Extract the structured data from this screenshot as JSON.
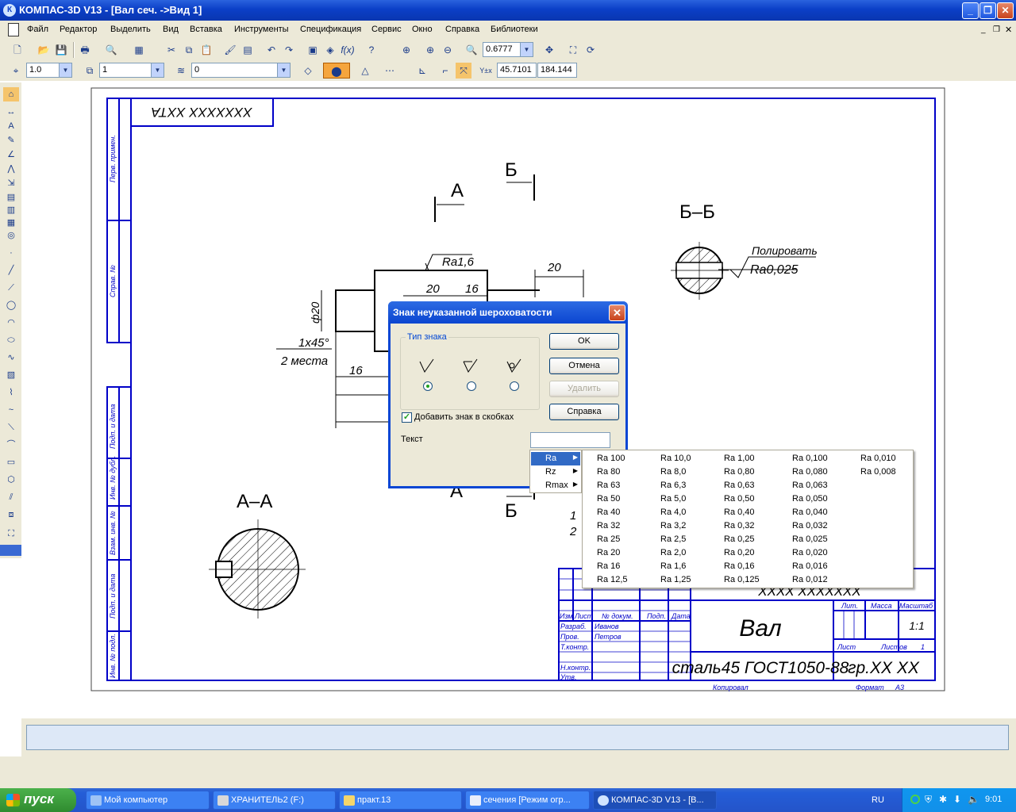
{
  "window": {
    "title": "КОМПАС-3D V13 - [Вал сеч. ->Вид 1]",
    "app_icon": "К"
  },
  "menu": [
    "Файл",
    "Редактор",
    "Выделить",
    "Вид",
    "Вставка",
    "Инструменты",
    "Спецификация",
    "Сервис",
    "Окно",
    "Справка",
    "Библиотеки"
  ],
  "toolbar": {
    "zoom": "0.6777",
    "style_value": "1.0",
    "layer_value": "1",
    "state_value": "0",
    "coord_x": "45.7101",
    "coord_y": "184.144"
  },
  "drawing": {
    "doc_code": "XXXXXXX XXTA",
    "section_a_label": "А",
    "section_b_label": "Б",
    "section_bb_title": "Б–Б",
    "section_aa_title": "А–А",
    "roughness_top": "Ra1,6",
    "polish_note": "Полировать",
    "polish_roughness": "Ra0,025",
    "dim_20_top": "20",
    "dim_20": "20",
    "dim_16": "16",
    "dim_16_left": "16",
    "dim_phi20": "ф20",
    "chamfer": "1х45°",
    "chamfer_places": "2 места",
    "side_labels": [
      "Перв. примен.",
      "Справ. №",
      "Подп. и дата",
      "Инв. № дубл.",
      "Взам. инв. №",
      "Подп. и дата",
      "Инв. № подл."
    ],
    "title_block": {
      "part_name": "Вал",
      "material": "сталь45 ГОСТ1050-88",
      "group": "гр.XX XX",
      "scale": "1:1",
      "copied": "Копировал",
      "format": "Формат",
      "format_value": "А3",
      "lit": "Лит.",
      "mass": "Масса",
      "scale_label": "Масштаб",
      "sheet": "Лист",
      "sheets": "Листов",
      "sheets_value": "1",
      "header_cols": [
        "Изм.",
        "Лист",
        "№ докум.",
        "Подп.",
        "Дата"
      ],
      "row_labels": [
        "Разраб.",
        "Пров.",
        "Т.контр.",
        "",
        "Н.контр.",
        "Утв."
      ],
      "developer": "Иванов",
      "checker": "Петров",
      "doc_code_small": "XXXX XXXXXXX"
    },
    "margin_numbers": [
      "1",
      "2"
    ]
  },
  "dialog": {
    "title": "Знак неуказанной шероховатости",
    "group_label": "Тип знака",
    "ok": "OK",
    "cancel": "Отмена",
    "delete": "Удалить",
    "help": "Справка",
    "checkbox_label": "Добавить знак в скобках",
    "checkbox_checked": true,
    "text_label": "Текст",
    "text_value": ""
  },
  "submenu": [
    "Ra",
    "Rz",
    "Rmax"
  ],
  "ra_values": [
    [
      "Ra 100",
      "Ra 80",
      "Ra 63",
      "Ra 50",
      "Ra 40",
      "Ra 32",
      "Ra 25",
      "Ra 20",
      "Ra 16",
      "Ra 12,5"
    ],
    [
      "Ra 10,0",
      "Ra 8,0",
      "Ra 6,3",
      "Ra 5,0",
      "Ra 4,0",
      "Ra 3,2",
      "Ra 2,5",
      "Ra 2,0",
      "Ra 1,6",
      "Ra 1,25"
    ],
    [
      "Ra 1,00",
      "Ra 0,80",
      "Ra 0,63",
      "Ra 0,50",
      "Ra 0,40",
      "Ra 0,32",
      "Ra 0,25",
      "Ra 0,20",
      "Ra 0,16",
      "Ra 0,125"
    ],
    [
      "Ra 0,100",
      "Ra 0,080",
      "Ra 0,063",
      "Ra 0,050",
      "Ra 0,040",
      "Ra 0,032",
      "Ra 0,025",
      "Ra 0,020",
      "Ra 0,016",
      "Ra 0,012"
    ],
    [
      "Ra 0,010",
      "Ra 0,008"
    ]
  ],
  "taskbar": {
    "start": "пуск",
    "tasks": [
      "Мой компьютер",
      "ХРАНИТЕЛЬ2 (F:)",
      "практ.13",
      "сечения [Режим огр...",
      "КОМПАС-3D V13 - [В..."
    ],
    "lang": "RU",
    "clock": "9:01"
  },
  "colors": {
    "drawing_line": "#0000c8",
    "taskbar": "#245dd7",
    "menu_highlight": "#316ac5"
  }
}
